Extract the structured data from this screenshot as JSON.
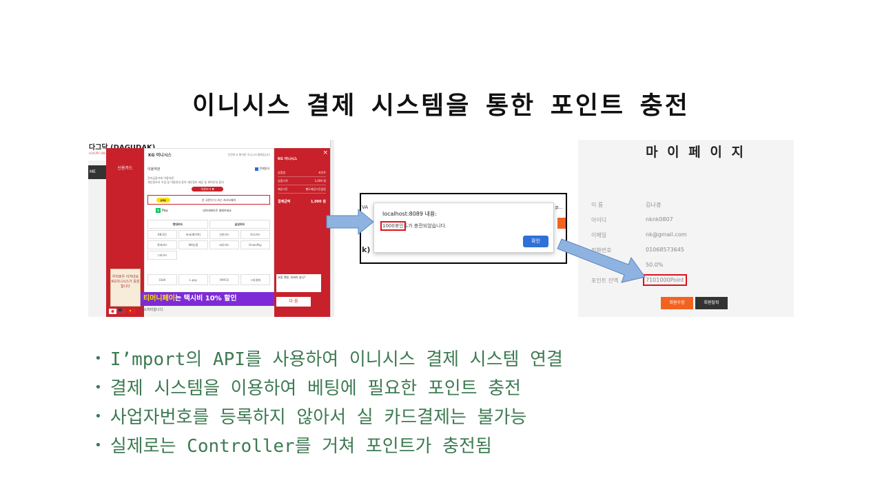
{
  "slide": {
    "title": "이니시스 결제 시스템을 통한 포인트 충전",
    "bullets": [
      "I’mport의 API를 사용하여 이니시스 결제 시스템 연결",
      "결제 시스템을 이용하여 베팅에 필요한 포인트 충전",
      "사업자번호를 등록하지 않아서 실 카드결제는 불가능",
      "실제로는 Controller를 거쳐 포인트가 충전됨"
    ]
  },
  "inicis": {
    "site_name": "다그닥 (DAGUDAK)",
    "site_sub": "LUXURY UNI",
    "left_strip": "ME",
    "method_credit": "신용카드",
    "banner": "우리로우 이겨내요 KG이니시스가 응원합니다",
    "logo": "KG 이니시스",
    "tagline": "안전하고 편리한 이니시스결제입니다",
    "agree_label": "이용약관",
    "agree_all": "전체동의",
    "terms1": "전자금융거래 이용약관",
    "terms2": "개인정보의 수집 및 이용안내   동의   개인정보 제공 및 위탁안내   동의",
    "view_terms": "약관보기 ▼",
    "kakao_badge": "pay",
    "kakao_text": "온 국민이 다 쓰는 카카오페이",
    "naver_badge": "N",
    "naver_pay": "Pay",
    "naver_text": "네이버페이로 결제하세요",
    "cards": [
      [
        "현대카드",
        "삼성카드"
      ],
      [
        "KB국민",
        "비씨(페이북)",
        "신한카드",
        "하나카드"
      ],
      [
        "롯데카드",
        "NH농협",
        "씨티카드",
        "UnionPay"
      ],
      [
        "그외카드"
      ]
    ],
    "easy_pay": [
      "CHAI",
      "L.pay",
      "PAYCO",
      "그외결제"
    ],
    "tmoney_label": "티머니페이",
    "tmoney_text": "는 택시비 10% 할인",
    "status": "취소처리합니다.",
    "right_logo": "KG 이니시스",
    "close": "×",
    "info": [
      {
        "label": "상품명",
        "value": "포인트"
      },
      {
        "label": "상품가격",
        "value": "1,000 원"
      },
      {
        "label": "제공기간",
        "value": "별도제공기간없음"
      }
    ],
    "amount_label": "결제금액",
    "amount_value": "1,000 원",
    "ad_text": "요즘 렌탈, 비싸지 않니?",
    "next_button": "다 음"
  },
  "alert": {
    "host": "localhost:8089 내용:",
    "msg_highlight": "1000포인",
    "msg_rest": "트가 충전되었습니다.",
    "ok_button": "확인",
    "bg_bracket": "k)",
    "bg_va": "VA",
    "bg_p": "p..."
  },
  "mypage": {
    "title": "마 이 페 이 지",
    "rows": [
      {
        "label": "이 름",
        "value": "김나경"
      },
      {
        "label": "아이디",
        "value": "nknk0807"
      },
      {
        "label": "이메일",
        "value": "nk@gmail.com"
      },
      {
        "label": "전화번호",
        "value": "01068573645"
      },
      {
        "label": "",
        "value": "50.0%"
      },
      {
        "label": "포인트 잔액",
        "value": "7101000Point"
      }
    ],
    "edit_button": "회원수정",
    "withdraw_button": "회원탈퇴"
  },
  "colors": {
    "bullet_text": "#3d7a52",
    "inicis_red": "#c8212b",
    "highlight_box": "#e0101a",
    "arrow_fill": "#8fb3e0"
  }
}
